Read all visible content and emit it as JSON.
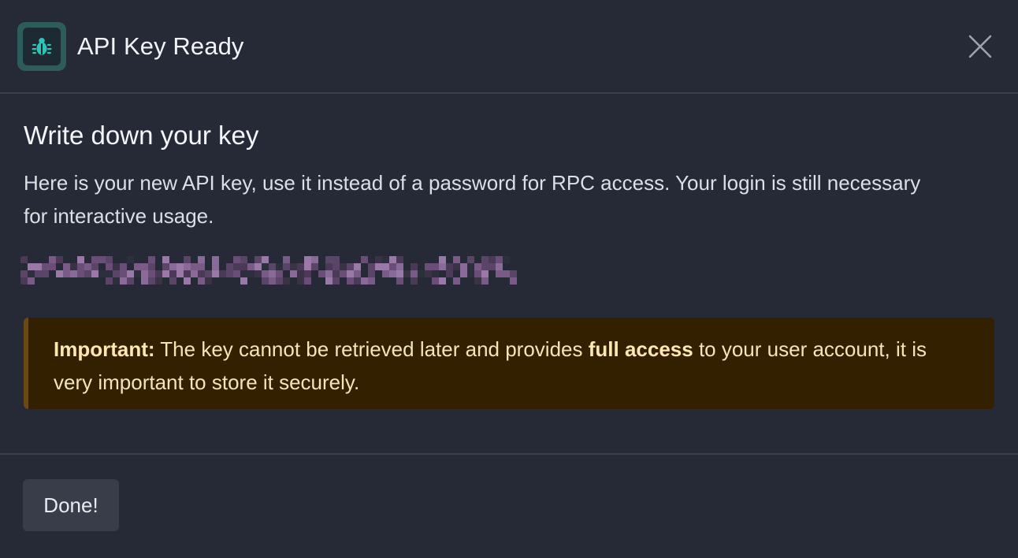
{
  "dialog": {
    "title": "API Key Ready",
    "icon": "bug-icon",
    "close_icon": "close-icon"
  },
  "body": {
    "heading": "Write down your key",
    "description": "Here is your new API key, use it instead of a password for RPC access. Your login is still necessary for interactive usage.",
    "api_key": "████████████████████████████████████████████████████"
  },
  "warning": {
    "prefix": "Important:",
    "text_before": " The key cannot be retrieved later and provides ",
    "emphasis": "full access",
    "text_after": " to your user account, it is very important to store it securely."
  },
  "footer": {
    "done_label": "Done!"
  },
  "colors": {
    "background": "#262a36",
    "accent": "#2ec4b6",
    "warning_bg": "#332001",
    "warning_text": "#f6e3b6",
    "redaction": "#7a5a86"
  }
}
